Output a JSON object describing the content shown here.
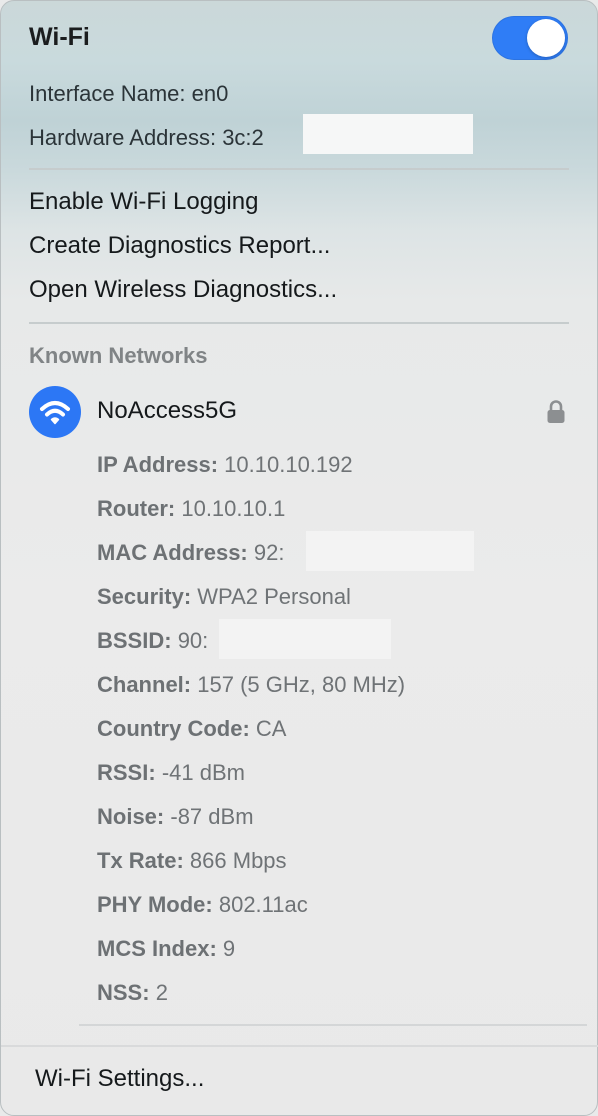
{
  "header": {
    "title": "Wi-Fi",
    "toggle_on": true,
    "accent_color": "#2f7df6"
  },
  "interface": {
    "name_label": "Interface Name: en0",
    "hardware_label": "Hardware Address: 3c:2"
  },
  "menu_items": [
    "Enable Wi-Fi Logging",
    "Create Diagnostics Report...",
    "Open Wireless Diagnostics..."
  ],
  "known_networks": {
    "heading": "Known Networks",
    "network": {
      "name": "NoAccess5G",
      "icon": "wifi-icon",
      "locked": true,
      "details": [
        {
          "key": "IP Address:",
          "value": "10.10.10.192"
        },
        {
          "key": "Router:",
          "value": "10.10.10.1"
        },
        {
          "key": "MAC Address:",
          "value": "92:"
        },
        {
          "key": "Security:",
          "value": "WPA2 Personal"
        },
        {
          "key": "BSSID:",
          "value": "90:"
        },
        {
          "key": "Channel:",
          "value": "157 (5 GHz, 80 MHz)"
        },
        {
          "key": "Country Code:",
          "value": "CA"
        },
        {
          "key": "RSSI:",
          "value": "-41 dBm"
        },
        {
          "key": "Noise:",
          "value": "-87 dBm"
        },
        {
          "key": "Tx Rate:",
          "value": "866 Mbps"
        },
        {
          "key": "PHY Mode:",
          "value": "802.11ac"
        },
        {
          "key": "MCS Index:",
          "value": "9"
        },
        {
          "key": "NSS:",
          "value": "2"
        }
      ]
    }
  },
  "footer": {
    "settings_label": "Wi-Fi Settings..."
  }
}
